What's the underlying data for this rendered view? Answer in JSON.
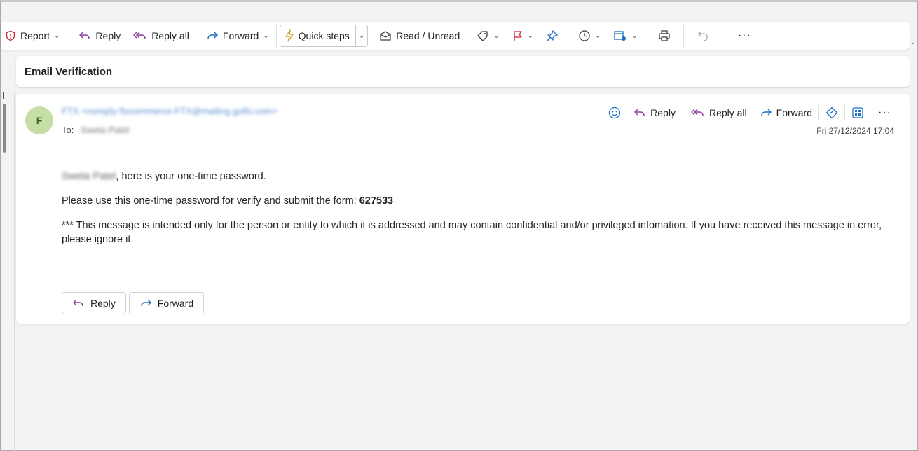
{
  "toolbar": {
    "report_label": "Report",
    "reply_label": "Reply",
    "reply_all_label": "Reply all",
    "forward_label": "Forward",
    "quick_steps_label": "Quick steps",
    "read_unread_label": "Read / Unread"
  },
  "email": {
    "subject": "Email Verification",
    "avatar_initial": "F",
    "from": "FTX <noreply-ftxcommerce-FTX@mailing.golfo.com>",
    "to_label": "To:",
    "to_name": "Sweta Patel",
    "date": "Fri 27/12/2024 17:04",
    "actions": {
      "reply_label": "Reply",
      "reply_all_label": "Reply all",
      "forward_label": "Forward"
    },
    "body": {
      "greeting_name": "Sweta Patel",
      "greeting_rest": ", here is your one-time password.",
      "otp_prefix": "Please use this one-time password for verify and submit the form: ",
      "otp_code": "627533",
      "disclaimer": "*** This message is intended only for the person or entity to which it is addressed and may contain confidential and/or privileged infomation. If you have received this message in error, please ignore it."
    },
    "bottom_buttons": {
      "reply_label": "Reply",
      "forward_label": "Forward"
    }
  },
  "colors": {
    "reply_icon": "#8a3f9e",
    "forward_icon": "#1e6fc7",
    "report_icon": "#c4262e",
    "flag_icon": "#c4262e",
    "accent": "#0f6cbd"
  }
}
